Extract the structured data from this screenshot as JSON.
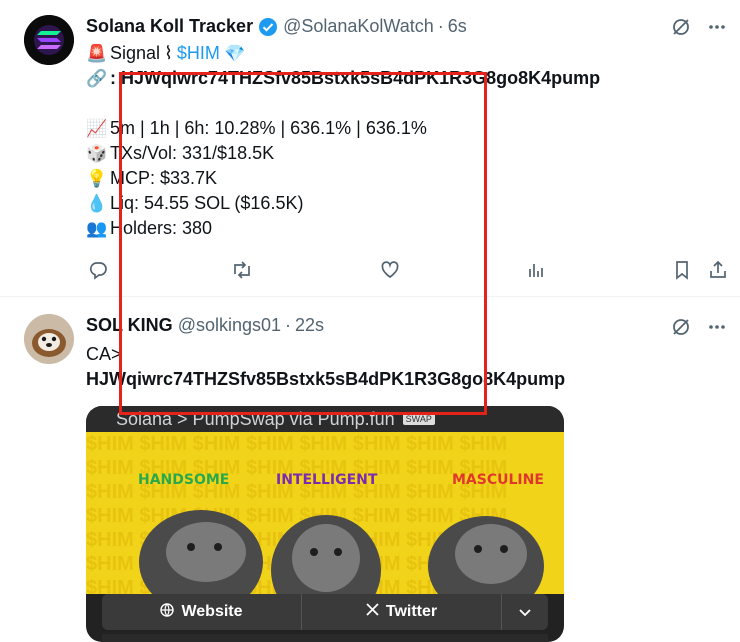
{
  "tweet1": {
    "display_name": "Solana Koll Tracker",
    "handle": "@SolanaKolWatch",
    "time": "6s",
    "signal_emoji": "🚨",
    "signal_word": "Signal",
    "signal_sep": "⌇",
    "cashtag": "$HIM",
    "gem_emoji": "💎",
    "link_emoji": "🔗",
    "contract": ": HJWqiwrc74THZSfv85Bstxk5sB4dPK1R3G8go8K4pump",
    "lines": [
      {
        "emoji": "📈",
        "text": "5m | 1h | 6h:  10.28% | 636.1% | 636.1%"
      },
      {
        "emoji": "🎲",
        "text": "TXs/Vol: 331/$18.5K"
      },
      {
        "emoji": "💡",
        "text": "MCP: $33.7K"
      },
      {
        "emoji": "💧",
        "text": "Liq: 54.55 SOL ($16.5K)"
      },
      {
        "emoji": "👥",
        "text": "Holders: 380"
      }
    ]
  },
  "tweet2": {
    "display_name": "SOL KING",
    "handle": "@solkings01",
    "time": "22s",
    "line1": "CA>",
    "contract": "HJWqiwrc74THZSfv85Bstxk5sB4dPK1R3G8go8K4pump",
    "card": {
      "top_text": "Solana  >    PumpSwap  via   Pump.fun",
      "swap_label": "SWAP",
      "word_1": "HANDSOME",
      "word_2": "INTELLIGENT",
      "word_3": "MASCULINE",
      "bg_word": "$HIM $HIM $HIM $HIM $HIM $HIM $HIM $HIM",
      "button_website": "Website",
      "button_x": "Twitter",
      "button_more": "⌄"
    }
  },
  "colors": {
    "link": "#1d9bf0",
    "annotation": "#e5231b",
    "secondary_text": "#536471"
  }
}
